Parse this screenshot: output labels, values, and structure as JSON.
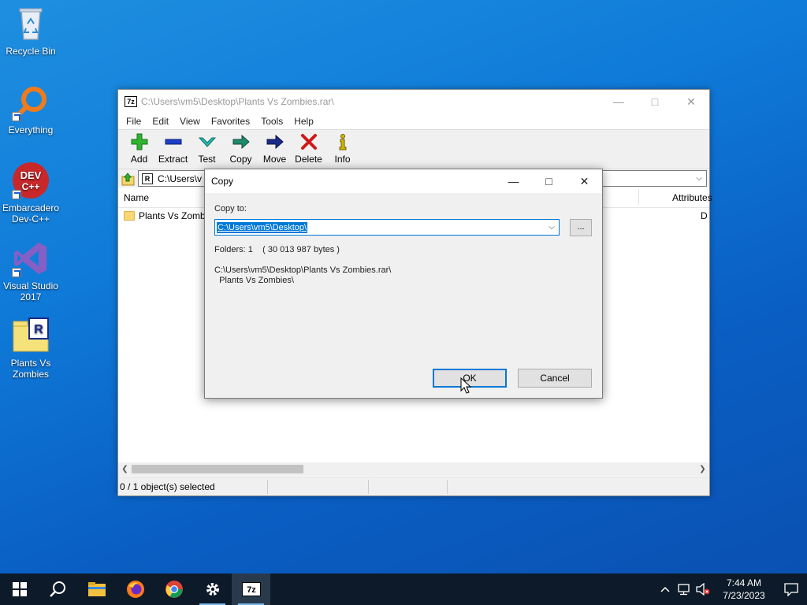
{
  "desktop": {
    "icons": [
      {
        "label": "Recycle Bin",
        "icon": "recycle-bin-icon"
      },
      {
        "label": "Everything",
        "icon": "everything-search-icon"
      },
      {
        "label": "Embarcadero Dev-C++",
        "icon": "devcpp-icon",
        "badge": "DEV C++"
      },
      {
        "label": "Visual Studio 2017",
        "icon": "visual-studio-icon"
      },
      {
        "label": "Plants Vs Zombies",
        "icon": "rar-archive-icon",
        "badge": "R"
      }
    ]
  },
  "window": {
    "app_icon": "7z",
    "title": "C:\\Users\\vm5\\Desktop\\Plants Vs Zombies.rar\\",
    "menu": [
      "File",
      "Edit",
      "View",
      "Favorites",
      "Tools",
      "Help"
    ],
    "toolbar": [
      {
        "label": "Add",
        "icon": "add-icon",
        "color": "#2fb52f"
      },
      {
        "label": "Extract",
        "icon": "extract-icon",
        "color": "#1c3fc8"
      },
      {
        "label": "Test",
        "icon": "test-icon",
        "color": "#27b8b0"
      },
      {
        "label": "Copy",
        "icon": "copy-icon",
        "color": "#1f8a6a"
      },
      {
        "label": "Move",
        "icon": "move-icon",
        "color": "#1b2a8a"
      },
      {
        "label": "Delete",
        "icon": "delete-icon",
        "color": "#d01818"
      },
      {
        "label": "Info",
        "icon": "info-icon",
        "color": "#d4b800"
      }
    ],
    "address": "C:\\Users\\vm5\\Desktop\\Plants Vs Zombies.rar\\",
    "address_visible": "C:\\Users\\v",
    "columns": {
      "name": "Name",
      "attributes": "Attributes"
    },
    "rows": [
      {
        "name": "Plants Vs Zombies",
        "attributes": "D"
      }
    ],
    "status": "0 / 1 object(s) selected"
  },
  "dialog": {
    "title": "Copy",
    "copy_to_label": "Copy to:",
    "copy_to_value": "C:\\Users\\vm5\\Desktop\\",
    "browse_label": "...",
    "folders_info": "Folders: 1    ( 30 013 987 bytes )",
    "path_line1": "C:\\Users\\vm5\\Desktop\\Plants Vs Zombies.rar\\",
    "path_line2": "  Plants Vs Zombies\\",
    "ok_label": "OK",
    "cancel_label": "Cancel"
  },
  "taskbar": {
    "apps": [
      "start",
      "search",
      "file-explorer",
      "firefox",
      "chrome",
      "settings",
      "7-zip"
    ],
    "time": "7:44 AM",
    "date": "7/23/2023"
  },
  "colors": {
    "accent": "#0078d7",
    "taskbar": "#0c1a29",
    "desktop": "#0f7ad8"
  }
}
